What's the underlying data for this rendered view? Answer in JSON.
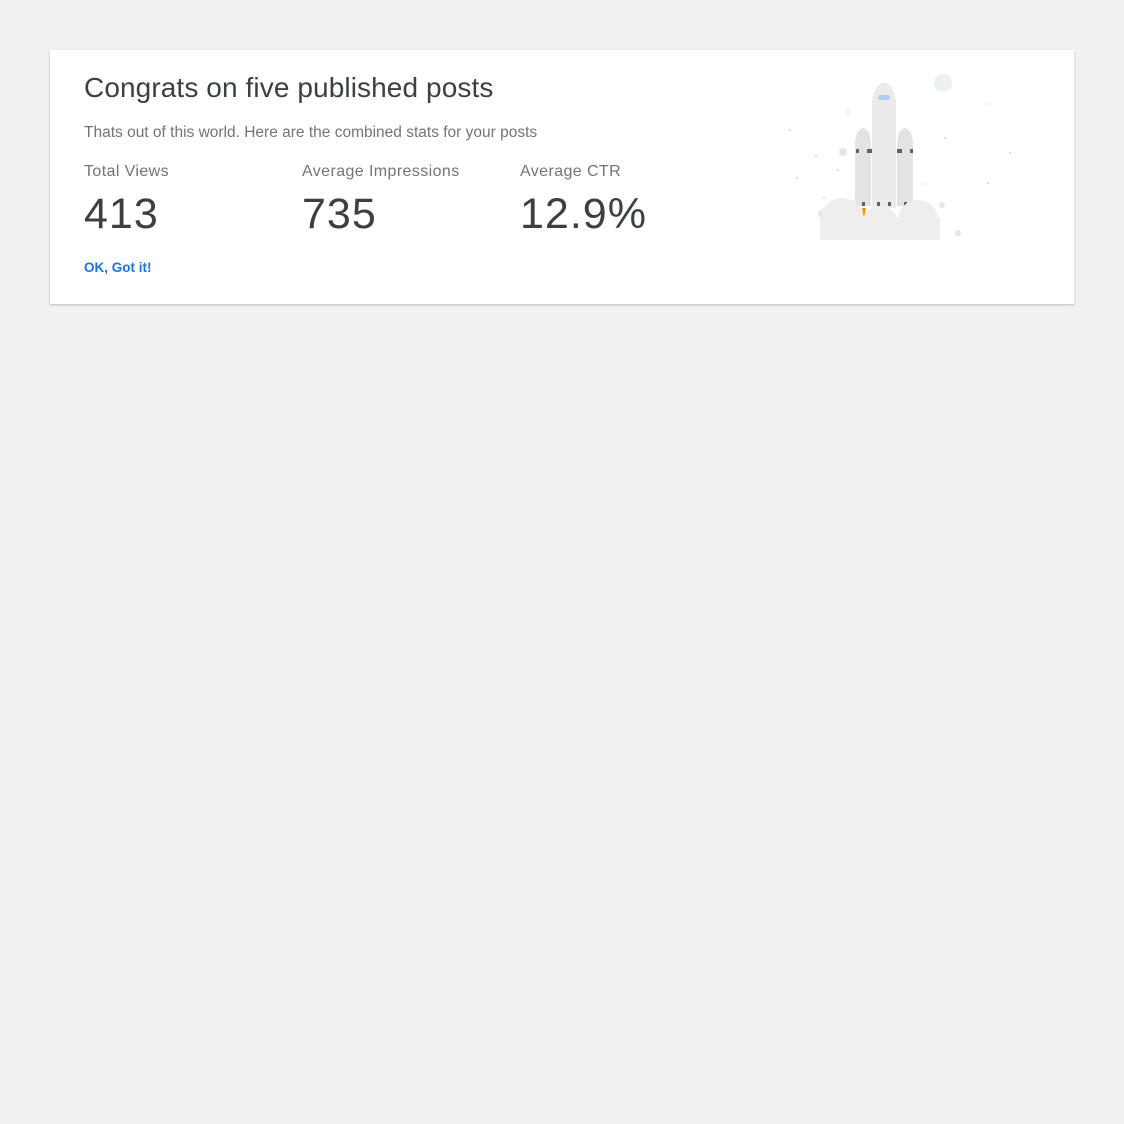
{
  "card": {
    "title": "Congrats on five published posts",
    "subtitle": "Thats out of this world. Here are the combined stats for your posts",
    "stats": [
      {
        "label": "Total Views",
        "value": "413"
      },
      {
        "label": "Average Impressions",
        "value": "735"
      },
      {
        "label": "Average CTR",
        "value": "12.9%"
      }
    ],
    "ok_label": "OK, Got it!",
    "illustration_icon": "rocket-launch-icon"
  },
  "colors": {
    "page_background": "#f1f1f1",
    "card_background": "#ffffff",
    "title_text": "#3c4043",
    "secondary_text": "#70757a",
    "link_blue": "#1a73e8",
    "rocket_body": "#e8e8e8",
    "flame": "#f29900"
  }
}
